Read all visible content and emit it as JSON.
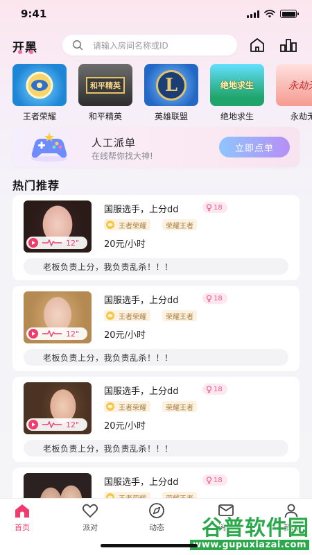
{
  "status_bar": {
    "time": "9:41"
  },
  "header": {
    "brand": "开黑",
    "search_placeholder": "请输入房间名称或ID"
  },
  "games": [
    {
      "label": "王者荣耀"
    },
    {
      "label": "和平精英",
      "tile_text": "和平精英"
    },
    {
      "label": "英雄联盟",
      "tile_text": "L"
    },
    {
      "label": "绝地求生",
      "tile_text": "绝地求生"
    },
    {
      "label": "永劫无",
      "tile_text": "永劫无"
    }
  ],
  "banner": {
    "title": "人工派单",
    "subtitle": "在线帮你找大神!",
    "button": "立即点单"
  },
  "section_title": "热门推荐",
  "cards": [
    {
      "title": "国服选手，上分dd",
      "gender_age": "18",
      "game_tag": "王者荣耀",
      "rank_tag": "荣耀王者",
      "price": "20元/小时",
      "voice_duration": "12\"",
      "desc": "老板负责上分，我负责乱杀！！！"
    },
    {
      "title": "国服选手，上分dd",
      "gender_age": "18",
      "game_tag": "王者荣耀",
      "rank_tag": "荣耀王者",
      "price": "20元/小时",
      "voice_duration": "12\"",
      "desc": "老板负责上分，我负责乱杀！！！"
    },
    {
      "title": "国服选手，上分dd",
      "gender_age": "18",
      "game_tag": "王者荣耀",
      "rank_tag": "荣耀王者",
      "price": "20元/小时",
      "voice_duration": "12\"",
      "desc": "老板负责上分，我负责乱杀！！！"
    },
    {
      "title": "国服选手，上分dd",
      "gender_age": "18",
      "game_tag": "王者荣耀",
      "rank_tag": "荣耀王者"
    }
  ],
  "tabbar": [
    {
      "label": "首页",
      "icon": "home-icon",
      "active": true
    },
    {
      "label": "派对",
      "icon": "heart-icon"
    },
    {
      "label": "动态",
      "icon": "compass-icon"
    },
    {
      "label": "消息",
      "icon": "message-icon"
    },
    {
      "label": "我的",
      "icon": "profile-icon"
    }
  ],
  "watermark": {
    "text": "谷普软件园",
    "url": "www.gupuxiazai.com"
  },
  "colors": {
    "accent": "#f03b6e",
    "button_gradient_start": "#8ec5fb",
    "button_gradient_end": "#b68ff5",
    "tag_bg": "#fdf2e2",
    "tag_text": "#a77d3c"
  }
}
